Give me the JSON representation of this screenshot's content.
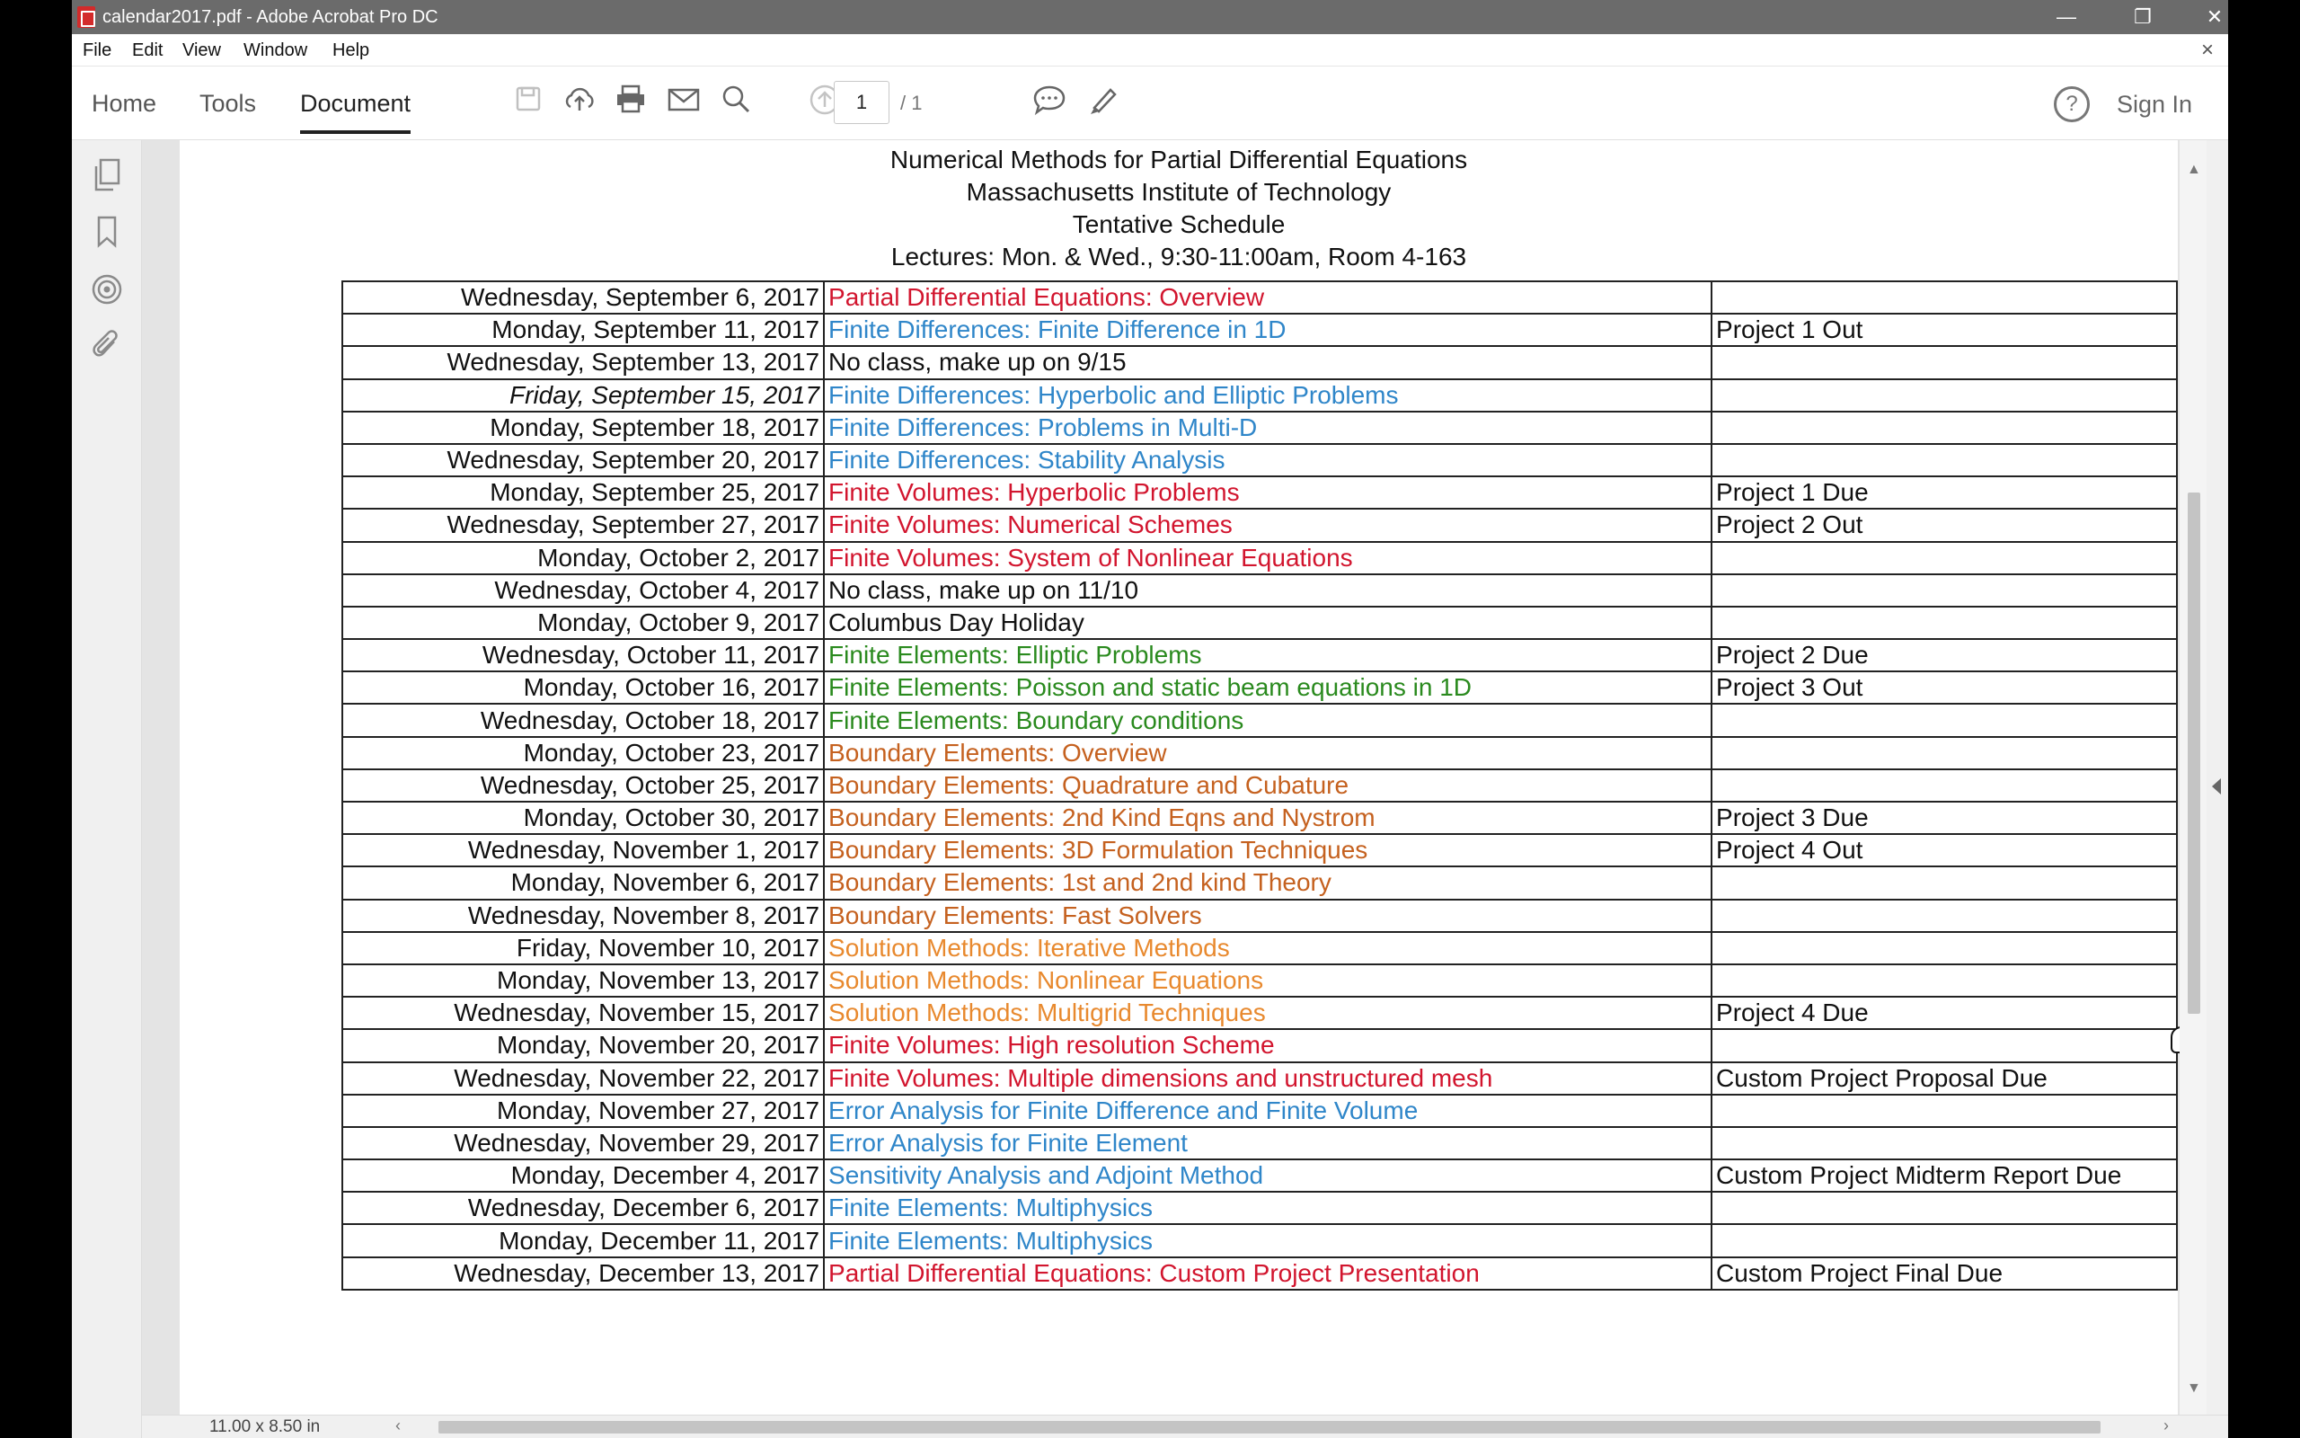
{
  "window": {
    "title": "calendar2017.pdf - Adobe Acrobat Pro DC",
    "controls": {
      "minimize": "—",
      "maximize": "❐",
      "close": "✕"
    }
  },
  "menu": {
    "items": [
      "File",
      "Edit",
      "View",
      "Window",
      "Help"
    ],
    "close_doc": "×"
  },
  "toolbar": {
    "tabs": {
      "home": "Home",
      "tools": "Tools",
      "document": "Document"
    },
    "page_current": "1",
    "page_total": "/ 1",
    "help": "?",
    "sign_in": "Sign In",
    "icons": [
      "save-icon",
      "upload-icon",
      "print-icon",
      "email-icon",
      "search-icon",
      "previous-page-icon",
      "next-page-icon",
      "comment-icon",
      "highlight-pen-icon"
    ]
  },
  "left_rail": {
    "icons": [
      "pages-icon",
      "bookmark-icon",
      "target-icon",
      "attachment-icon"
    ]
  },
  "document": {
    "heading": [
      "Numerical Methods for Partial Differential Equations",
      "Massachusetts Institute of Technology",
      "Tentative Schedule",
      "Lectures: Mon. & Wed., 9:30-11:00am, Room 4-163"
    ],
    "category_colors": {
      "red": "#d2152e",
      "blue": "#2f86c9",
      "green": "#2a8a1e",
      "brown": "#c5611f",
      "orange": "#e8892e",
      "black": "#111111"
    },
    "rows": [
      {
        "date": "Wednesday, September 6, 2017",
        "topic": "Partial Differential Equations: Overview",
        "note": "",
        "cat": "red"
      },
      {
        "date": "Monday, September 11, 2017",
        "topic": "Finite Differences: Finite Difference in 1D",
        "note": "Project 1 Out",
        "cat": "blue"
      },
      {
        "date": "Wednesday, September 13, 2017",
        "topic": "No class, make up on 9/15",
        "note": "",
        "cat": "black"
      },
      {
        "date": "Friday, September 15, 2017",
        "topic": "Finite Differences: Hyperbolic and Elliptic Problems",
        "note": "",
        "cat": "blue",
        "italic": true
      },
      {
        "date": "Monday, September 18, 2017",
        "topic": "Finite Differences: Problems in Multi-D",
        "note": "",
        "cat": "blue"
      },
      {
        "date": "Wednesday, September 20, 2017",
        "topic": "Finite Differences: Stability Analysis",
        "note": "",
        "cat": "blue"
      },
      {
        "date": "Monday, September 25, 2017",
        "topic": "Finite Volumes: Hyperbolic Problems",
        "note": "Project 1 Due",
        "cat": "red"
      },
      {
        "date": "Wednesday, September 27, 2017",
        "topic": "Finite Volumes: Numerical Schemes",
        "note": "Project 2 Out",
        "cat": "red"
      },
      {
        "date": "Monday, October 2, 2017",
        "topic": "Finite Volumes: System of Nonlinear Equations",
        "note": "",
        "cat": "red"
      },
      {
        "date": "Wednesday, October 4, 2017",
        "topic": "No class, make up on 11/10",
        "note": "",
        "cat": "black"
      },
      {
        "date": "Monday, October 9, 2017",
        "topic": "Columbus Day Holiday",
        "note": "",
        "cat": "black"
      },
      {
        "date": "Wednesday, October 11, 2017",
        "topic": "Finite Elements: Elliptic Problems",
        "note": "Project 2 Due",
        "cat": "green"
      },
      {
        "date": "Monday, October 16, 2017",
        "topic": "Finite Elements: Poisson and static beam equations in 1D",
        "note": "Project 3 Out",
        "cat": "green"
      },
      {
        "date": "Wednesday, October 18, 2017",
        "topic": "Finite Elements: Boundary conditions",
        "note": "",
        "cat": "green"
      },
      {
        "date": "Monday, October 23, 2017",
        "topic": "Boundary Elements: Overview",
        "note": "",
        "cat": "brown"
      },
      {
        "date": "Wednesday, October 25, 2017",
        "topic": "Boundary Elements: Quadrature and Cubature",
        "note": "",
        "cat": "brown"
      },
      {
        "date": "Monday, October 30, 2017",
        "topic": "Boundary Elements: 2nd Kind Eqns and Nystrom",
        "note": "Project 3 Due",
        "cat": "brown"
      },
      {
        "date": "Wednesday, November 1, 2017",
        "topic": "Boundary Elements: 3D Formulation Techniques",
        "note": "Project 4 Out",
        "cat": "brown"
      },
      {
        "date": "Monday, November 6, 2017",
        "topic": "Boundary Elements: 1st and 2nd kind Theory",
        "note": "",
        "cat": "brown"
      },
      {
        "date": "Wednesday, November 8, 2017",
        "topic": "Boundary Elements: Fast Solvers",
        "note": "",
        "cat": "brown"
      },
      {
        "date": "Friday, November 10, 2017",
        "topic": "Solution Methods: Iterative Methods",
        "note": "",
        "cat": "orange"
      },
      {
        "date": "Monday, November 13, 2017",
        "topic": "Solution Methods: Nonlinear Equations",
        "note": "",
        "cat": "orange"
      },
      {
        "date": "Wednesday, November 15, 2017",
        "topic": "Solution Methods: Multigrid Techniques",
        "note": "Project 4 Due",
        "cat": "orange"
      },
      {
        "date": "Monday, November 20, 2017",
        "topic": "Finite Volumes: High resolution Scheme",
        "note": "",
        "cat": "red"
      },
      {
        "date": "Wednesday, November 22, 2017",
        "topic": "Finite Volumes: Multiple dimensions and unstructured mesh",
        "note": "Custom Project Proposal Due",
        "cat": "red"
      },
      {
        "date": "Monday, November 27, 2017",
        "topic": "Error Analysis for Finite Difference and Finite Volume",
        "note": "",
        "cat": "blue"
      },
      {
        "date": "Wednesday, November 29, 2017",
        "topic": "Error Analysis for Finite Element",
        "note": "",
        "cat": "blue"
      },
      {
        "date": "Monday, December 4, 2017",
        "topic": "Sensitivity Analysis and Adjoint Method",
        "note": "Custom Project Midterm Report Due",
        "cat": "blue"
      },
      {
        "date": "Wednesday, December 6, 2017",
        "topic": "Finite Elements: Multiphysics",
        "note": "",
        "cat": "blue"
      },
      {
        "date": "Monday, December 11, 2017",
        "topic": "Finite Elements: Multiphysics",
        "note": "",
        "cat": "blue"
      },
      {
        "date": "Wednesday, December 13, 2017",
        "topic": "Partial Differential Equations: Custom Project Presentation",
        "note": "Custom Project Final Due",
        "cat": "red"
      }
    ]
  },
  "status": {
    "page_size": "11.00 x 8.50 in"
  }
}
